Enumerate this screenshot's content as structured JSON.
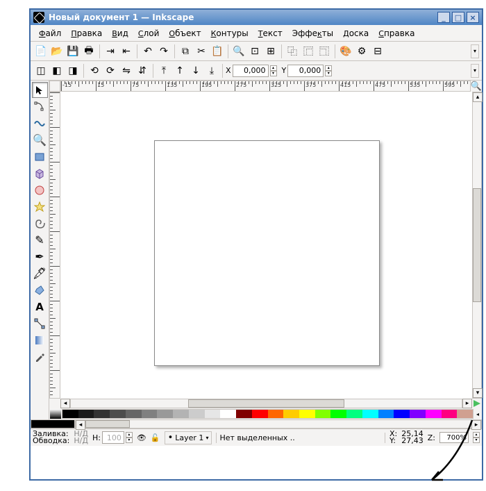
{
  "title": "Новый документ 1 — Inkscape",
  "menu": [
    "Файл",
    "Правка",
    "Вид",
    "Слой",
    "Объект",
    "Контуры",
    "Текст",
    "Эффекты",
    "Доска",
    "Справка"
  ],
  "menu_accel": [
    0,
    0,
    0,
    0,
    0,
    0,
    0,
    4,
    0,
    0
  ],
  "tool_options": {
    "x_label": "X",
    "x_value": "0,000",
    "y_label": "Y",
    "y_value": "0,000"
  },
  "ruler_ticks": [
    "-15",
    "15",
    "75",
    "135",
    "195",
    "275",
    "325",
    "375",
    "415",
    "475",
    "535",
    "595"
  ],
  "status": {
    "fill_label": "Заливка:",
    "fill_value": "Н/Д",
    "stroke_label": "Обводка:",
    "stroke_value": "Н/Д",
    "layer_label": "Layer 1",
    "sel_text": "Нет выделенных ..",
    "coord_x": "25,14",
    "coord_y": "27,43",
    "x_lbl": "X:",
    "y_lbl": "Y:",
    "z_lbl": "Z:",
    "zoom": "700%",
    "opacity_lbl": "Н:",
    "opacity_val": "100"
  },
  "palette": [
    "#000000",
    "#1a1a1a",
    "#333333",
    "#4d4d4d",
    "#666666",
    "#808080",
    "#999999",
    "#b3b3b3",
    "#cccccc",
    "#e6e6e6",
    "#ffffff",
    "#800000",
    "#ff0000",
    "#ff6600",
    "#ffcc00",
    "#ffff00",
    "#80ff00",
    "#00ff00",
    "#00ff80",
    "#00ffff",
    "#0080ff",
    "#0000ff",
    "#8000ff",
    "#ff00ff",
    "#ff0080",
    "#d0a090"
  ]
}
